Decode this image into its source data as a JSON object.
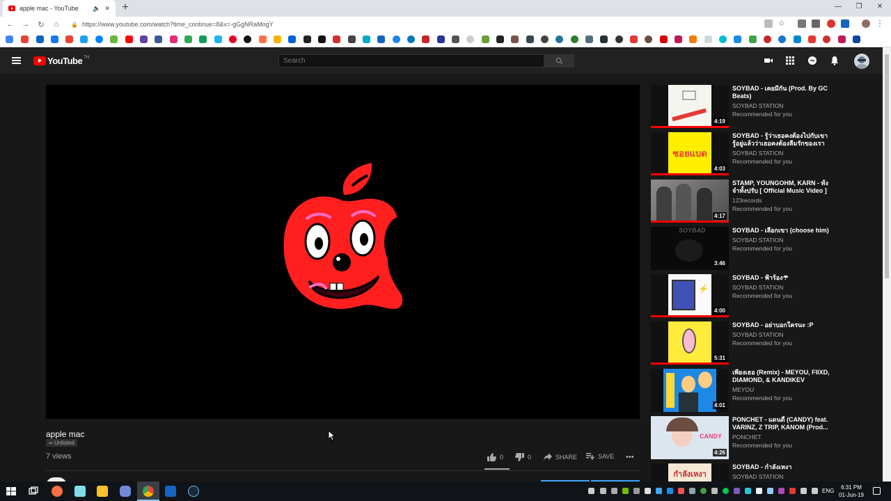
{
  "browser": {
    "tab_title": "apple mac - YouTube",
    "new_tab_label": "+",
    "url": "https://www.youtube.com/watch?time_continue=8&v=-gGgNRaMogY"
  },
  "youtube": {
    "logo_text": "YouTube",
    "region": "TH",
    "search_placeholder": "Search"
  },
  "video": {
    "title": "apple mac",
    "visibility": "Unlisted",
    "views": "7 views",
    "likes": "0",
    "dislikes": "0",
    "share_label": "SHARE",
    "save_label": "SAVE",
    "more_label": "•••"
  },
  "recommendations": [
    {
      "title": "SOYBAD - เคยมีกัน (Prod. By GC Beats)",
      "channel": "SOYBAD STATION",
      "sub": "Recommended for you",
      "duration": "4:19"
    },
    {
      "title": "SOYBAD - รู้ว่าเธอคงต้องไปกับเขา รู้อยู่แล้วว่าเธอคงต้องลืมรักของเรา",
      "channel": "SOYBAD STATION",
      "sub": "Recommended for you",
      "duration": "4:03"
    },
    {
      "title": "STAMP, YOUNGOHM, KARN - ทั้งจำทั้งปรับ [ Official Music Video ]",
      "channel": "123records",
      "sub": "Recommended for you",
      "duration": "4:17"
    },
    {
      "title": "SOYBAD - เลือกเขา (choose him)",
      "channel": "SOYBAD STATION",
      "sub": "Recommended for you",
      "duration": "3:46"
    },
    {
      "title": "SOYBAD - ฟ้าร้อง☂",
      "channel": "SOYBAD STATION",
      "sub": "Recommended for you",
      "duration": "4:00"
    },
    {
      "title": "SOYBAD - อย่าบอกใครนะ :P",
      "channel": "SOYBAD STATION",
      "sub": "Recommended for you",
      "duration": "5:31"
    },
    {
      "title": "เพียงเธอ (Remix) - MEYOU, FIIXD, DIAMOND, & KANDIKEV",
      "channel": "MEYOU",
      "sub": "Recommended for you",
      "duration": "4:01"
    },
    {
      "title": "PONCHET - แดนดี้ (CANDY) feat. VARINZ, Z TRIP, KANOM (Prod...",
      "channel": "PONCHET",
      "sub": "Recommended for you",
      "duration": "4:26"
    },
    {
      "title": "SOYBAD - กำลังเหงา",
      "channel": "SOYBAD STATION",
      "sub": "",
      "duration": ""
    }
  ],
  "thumb_labels": {
    "t2": "ซอยแบด",
    "t4": "SOYBAD",
    "t8": "CANDY",
    "t9": "กำลังเหงา"
  },
  "taskbar": {
    "lang": "ENG",
    "time": "6:31 PM",
    "date": "01-Jun-19"
  },
  "colors": {
    "yt_bg": "#181818",
    "yt_header": "#212121",
    "yt_red": "#ff0000",
    "apple_red": "#ff1f1f",
    "link_blue": "#3ea6ff"
  }
}
